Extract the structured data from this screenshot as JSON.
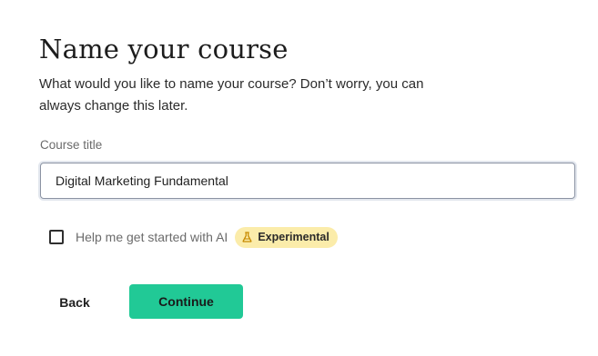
{
  "header": {
    "title": "Name your course",
    "subtitle": "What would you like to name your course? Don’t worry, you can always change this later."
  },
  "form": {
    "course_title_label": "Course title",
    "course_title_value": "Digital Marketing Fundamental",
    "ai_checkbox": {
      "label": "Help me get started with AI",
      "checked": false,
      "badge_label": "Experimental",
      "badge_icon": "flask-icon",
      "badge_color": "#fbecaa"
    }
  },
  "actions": {
    "back_label": "Back",
    "continue_label": "Continue",
    "continue_color": "#21c996"
  }
}
